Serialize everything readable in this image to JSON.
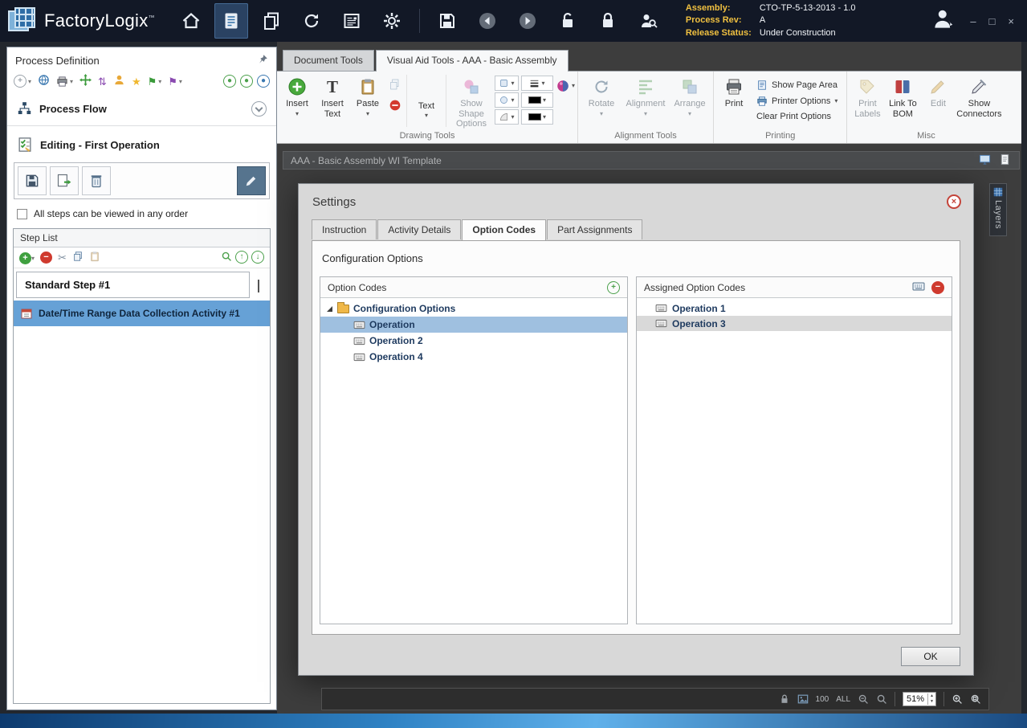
{
  "titlebar": {
    "app_name": "FactoryLogix",
    "trademark": "™",
    "info": {
      "assembly_label": "Assembly:",
      "assembly_value": "CTO-TP-5-13-2013 - 1.0",
      "process_rev_label": "Process Rev:",
      "process_rev_value": "A",
      "release_status_label": "Release Status:",
      "release_status_value": "Under Construction"
    }
  },
  "icons": {
    "caret_down": "▾",
    "scissors": "✂",
    "star": "★",
    "flag": "⚑",
    "sync_arrows": "⇅",
    "plus": "+",
    "minus": "−",
    "up_arrow": "↑",
    "down_arrow": "↓",
    "spin_up": "▲",
    "spin_down": "▼",
    "minimize": "–",
    "maximize": "□",
    "close": "×"
  },
  "sidebar": {
    "title": "Process Definition",
    "process_flow": "Process Flow",
    "editing_header": "Editing - First Operation",
    "checkbox_label": "All steps can be viewed in any order",
    "step_list_title": "Step List",
    "step_group_label": "Standard Step #1",
    "activity_label": "Date/Time Range Data Collection Activity #1"
  },
  "ribbon": {
    "tabs": [
      {
        "label": "Document Tools",
        "active": false
      },
      {
        "label": "Visual Aid Tools - AAA - Basic Assembly",
        "active": true
      }
    ],
    "buttons": {
      "insert": "Insert",
      "insert_text": "Insert\nText",
      "paste": "Paste",
      "text": "Text",
      "show_shape_options": "Show Shape\nOptions",
      "rotate": "Rotate",
      "alignment": "Alignment",
      "arrange": "Arrange",
      "print": "Print",
      "show_page_area": "Show Page Area",
      "printer_options": "Printer Options",
      "clear_print_options": "Clear Print Options",
      "print_labels": "Print\nLabels",
      "link_to_bom": "Link To\nBOM",
      "edit": "Edit",
      "show_connectors": "Show\nConnectors"
    },
    "groups": {
      "drawing": "Drawing Tools",
      "alignment": "Alignment Tools",
      "printing": "Printing",
      "misc": "Misc"
    }
  },
  "canvas": {
    "doc_title": "AAA - Basic Assembly WI Template",
    "layers_tab": "Layers",
    "status": {
      "val_100": "100",
      "val_all": "ALL",
      "zoom": "51%"
    }
  },
  "dialog": {
    "title": "Settings",
    "tabs": [
      "Instruction",
      "Activity Details",
      "Option Codes",
      "Part Assignments"
    ],
    "heading": "Configuration Options",
    "option_codes": {
      "header": "Option Codes",
      "root": "Configuration Options",
      "items": [
        "Operation",
        "Operation 2",
        "Operation 4"
      ]
    },
    "assigned": {
      "header": "Assigned Option Codes",
      "items": [
        "Operation 1",
        "Operation 3"
      ]
    },
    "ok": "OK"
  },
  "colors": {
    "titlebar_bg": "#121826",
    "accent_blue": "#2f6ea6",
    "gold_label": "#f0c040",
    "selection_blue": "#66a1d6",
    "tree_selection": "#9fc0e0",
    "dialog_bg": "#d8d8d8",
    "canvas_bg": "#3d3d3d",
    "disabled_text": "#9aa0a6"
  }
}
